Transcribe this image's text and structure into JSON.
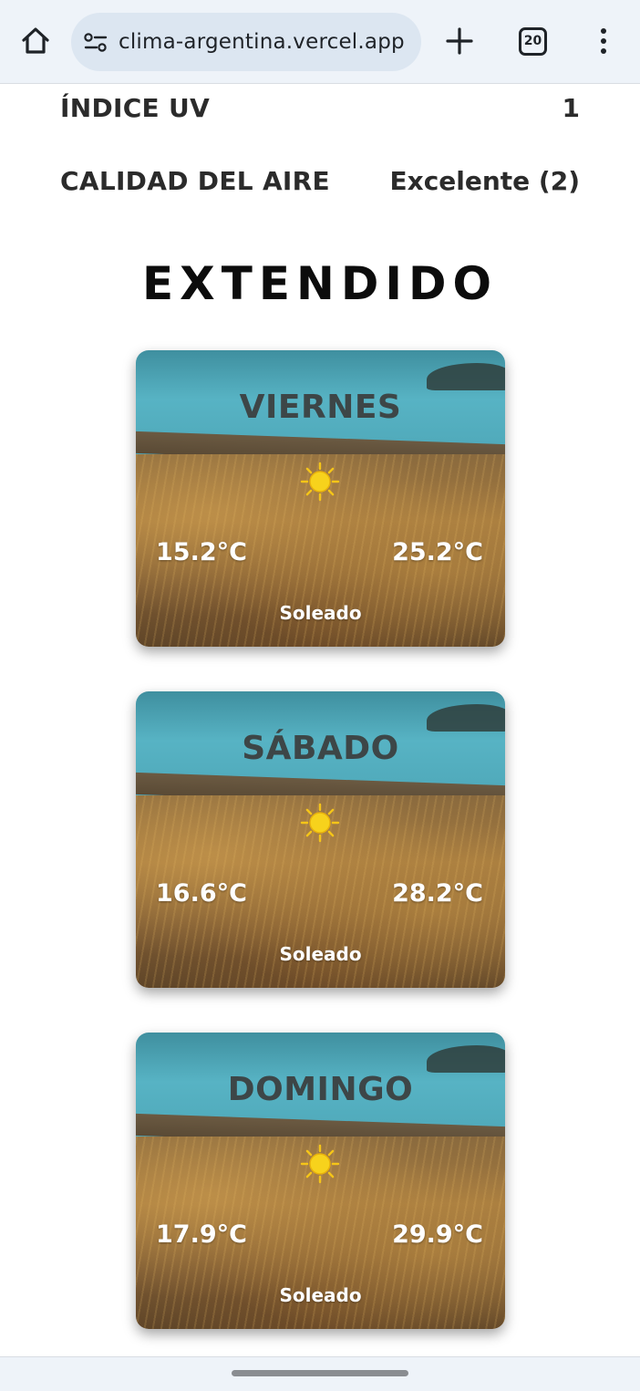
{
  "browser": {
    "url": "clima-argentina.vercel.app",
    "tab_count": "20"
  },
  "info": {
    "uv_label": "ÍNDICE UV",
    "uv_value": "1",
    "air_label": "CALIDAD DEL AIRE",
    "air_value": "Excelente (2)"
  },
  "extended": {
    "title": "EXTENDIDO",
    "days": [
      {
        "day": "VIERNES",
        "min": "15.2°C",
        "max": "25.2°C",
        "condition": "Soleado",
        "icon": "sun-icon"
      },
      {
        "day": "SÁBADO",
        "min": "16.6°C",
        "max": "28.2°C",
        "condition": "Soleado",
        "icon": "sun-icon"
      },
      {
        "day": "DOMINGO",
        "min": "17.9°C",
        "max": "29.9°C",
        "condition": "Soleado",
        "icon": "sun-icon"
      }
    ]
  },
  "colors": {
    "browser_bg": "#eef3f9",
    "sun": "#f5c518",
    "text_dark": "#2b2b2b"
  }
}
